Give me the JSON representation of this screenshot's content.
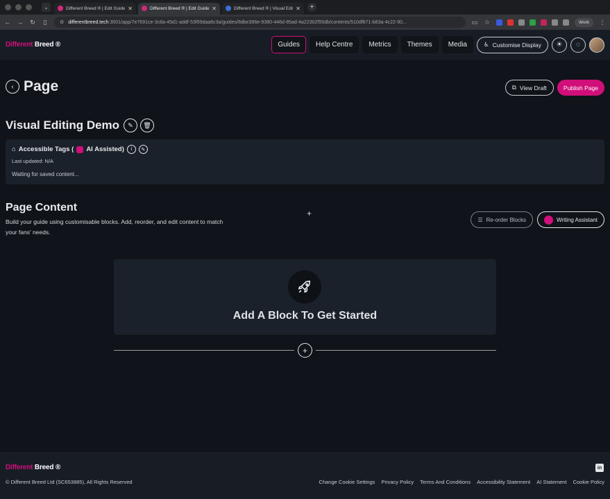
{
  "browser": {
    "tabs": [
      {
        "title": "Different Breed ® | Edit Guide",
        "active": false,
        "favicon": "brand"
      },
      {
        "title": "Different Breed ® | Edit Guide",
        "active": true,
        "favicon": "brand"
      },
      {
        "title": "Different Breed ® | Visual Edit",
        "active": false,
        "favicon": "blue"
      }
    ],
    "url_host": "differentbreed.tech",
    "url_path": ":3001/app/7e7691ce-3c8a-45d1-addf-53f99daa6c3a/guides/8dbe396e-9380-446d-85ad-4a22302f55db/contents/510df871-b83a-4c22-90...",
    "profile_label": "Work"
  },
  "header": {
    "logo_part1": "Different",
    "logo_part2": "Breed",
    "logo_mark": "®",
    "nav": [
      {
        "label": "Guides",
        "active": true
      },
      {
        "label": "Help Centre",
        "active": false
      },
      {
        "label": "Metrics",
        "active": false
      },
      {
        "label": "Themes",
        "active": false
      },
      {
        "label": "Media",
        "active": false
      }
    ],
    "customise_label": "Customise Display"
  },
  "page": {
    "title": "Page",
    "view_draft_label": "View Draft",
    "publish_label": "Publish Page"
  },
  "guide": {
    "title": "Visual Editing Demo"
  },
  "tags": {
    "heading": "Accessible Tags (",
    "ai_label": "AI Assisted)",
    "last_updated": "Last updated: N/A",
    "status": "Waiting for saved content..."
  },
  "content": {
    "title": "Page Content",
    "description": "Build your guide using customisable blocks. Add, reorder, and edit content to match your fans' needs.",
    "reorder_label": "Re-order Blocks",
    "writing_label": "Writing Assistant",
    "empty_title": "Add A Block To Get Started"
  },
  "footer": {
    "copyright": "© Different Breed Ltd (SC653885), All Rights Reserved",
    "links": [
      "Change Cookie Settings",
      "Privacy Policy",
      "Terms And Conditions",
      "Accessibility Statement",
      "AI Statement",
      "Cookie Policy"
    ]
  },
  "colors": {
    "brand": "#d10f7a",
    "background": "#101319",
    "surface": "#1b212a"
  }
}
